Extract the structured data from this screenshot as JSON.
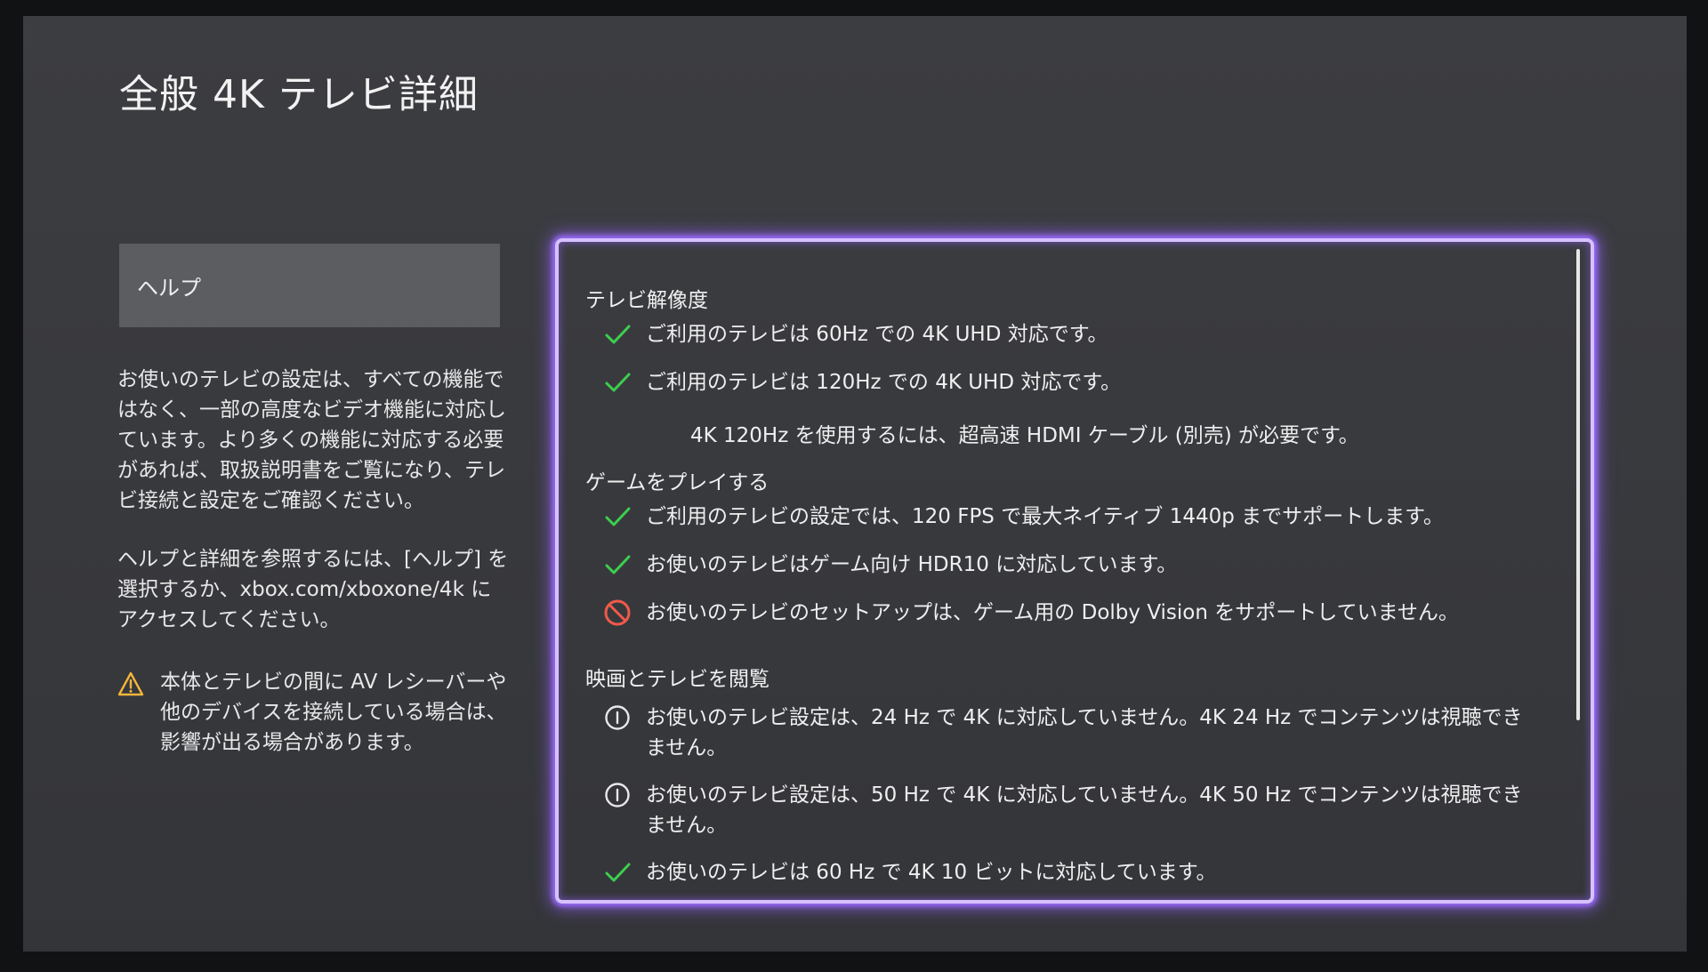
{
  "page": {
    "title": "全般 4K テレビ詳細"
  },
  "sidebar": {
    "help_label": "ヘルプ",
    "description": "お使いのテレビの設定は、すべての機能ではなく、一部の高度なビデオ機能に対応しています。より多くの機能に対応する必要があれば、取扱説明書をご覧になり、テレビ接続と設定をご確認ください。",
    "help_info": "ヘルプと詳細を参照するには、[ヘルプ] を選択するか、xbox.com/xboxone/4k にアクセスしてください。",
    "warning": "本体とテレビの間に AV レシーバーや他のデバイスを接続している場合は、影響が出る場合があります。",
    "warning_icon": "warning-icon",
    "warning_color": "#f5b63a"
  },
  "panel": {
    "sections": [
      {
        "title": "テレビ解像度",
        "items": [
          {
            "icon": "check-icon",
            "text": "ご利用のテレビは 60Hz での 4K UHD 対応です。"
          },
          {
            "icon": "check-icon",
            "text": "ご利用のテレビは 120Hz での 4K UHD 対応です。"
          }
        ],
        "note": "4K 120Hz を使用するには、超高速 HDMI ケーブル (別売) が必要です。"
      },
      {
        "title": "ゲームをプレイする",
        "items": [
          {
            "icon": "check-icon",
            "text": "ご利用のテレビの設定では、120 FPS で最大ネイティブ 1440p までサポートします。"
          },
          {
            "icon": "check-icon",
            "text": "お使いのテレビはゲーム向け HDR10 に対応しています。"
          },
          {
            "icon": "prohibited-icon",
            "text": "お使いのテレビのセットアップは、ゲーム用の Dolby Vision をサポートしていません。"
          }
        ]
      },
      {
        "title": "映画とテレビを閲覧",
        "items": [
          {
            "icon": "info-icon",
            "text": "お使いのテレビ設定は、24 Hz で 4K に対応していません。4K 24 Hz でコンテンツは視聴できません。"
          },
          {
            "icon": "info-icon",
            "text": "お使いのテレビ設定は、50 Hz で 4K に対応していません。4K 50 Hz でコンテンツは視聴できません。"
          },
          {
            "icon": "check-icon",
            "text": "お使いのテレビは 60 Hz で 4K 10 ビットに対応しています。"
          }
        ]
      }
    ],
    "colors": {
      "focus_border": "#d6c2ff",
      "glow": "#9b6cff",
      "check": "#3ccf4e",
      "prohibited": "#f05a4a",
      "info": "#e8e8e8"
    }
  }
}
